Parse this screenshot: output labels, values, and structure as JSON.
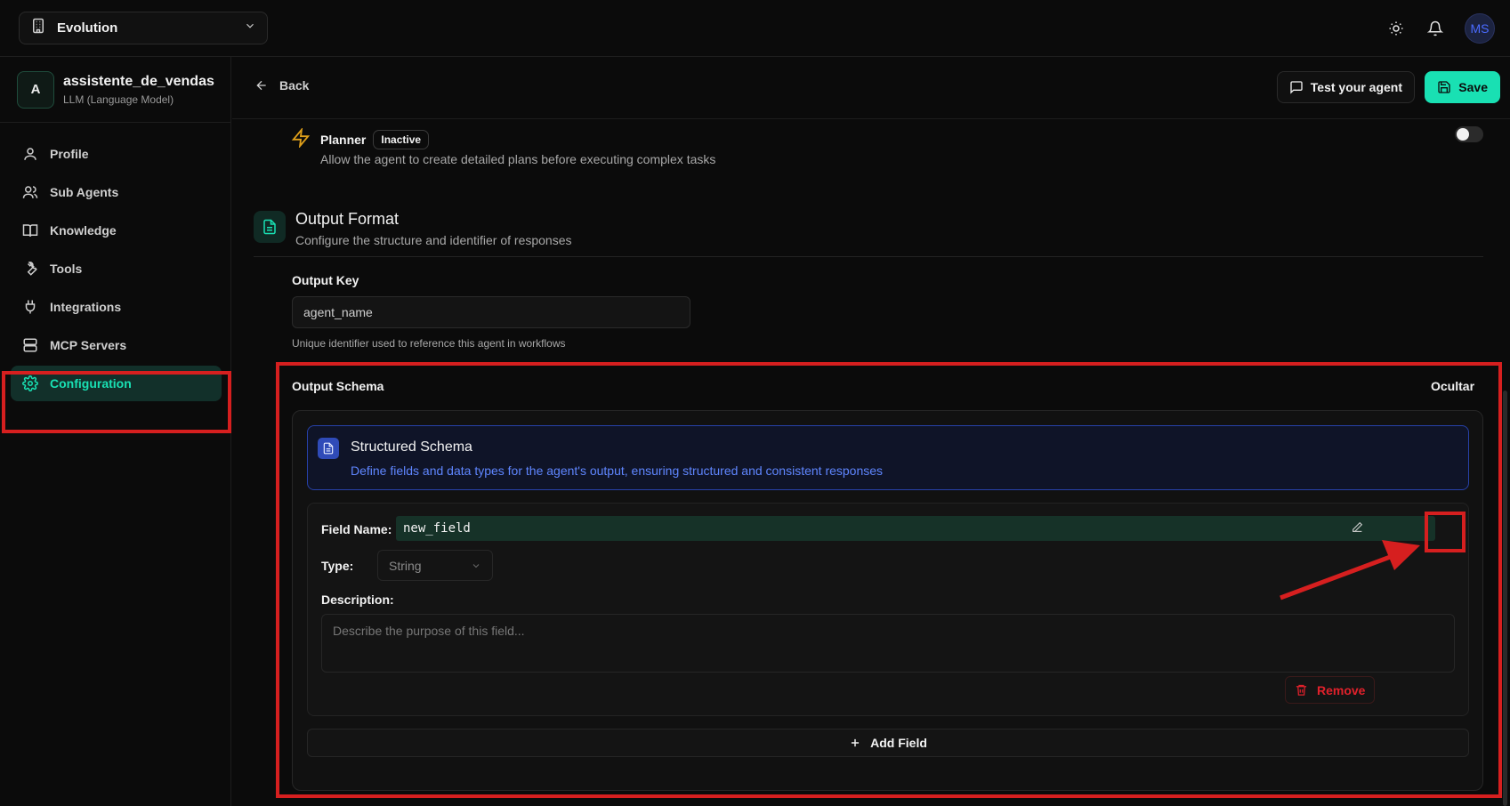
{
  "workspace": {
    "name": "Evolution"
  },
  "user": {
    "initials": "MS"
  },
  "agent": {
    "avatar_letter": "A",
    "name": "assistente_de_vendas",
    "type": "LLM (Language Model)"
  },
  "nav": {
    "items": [
      {
        "label": "Profile",
        "icon": "user-icon"
      },
      {
        "label": "Sub Agents",
        "icon": "users-icon"
      },
      {
        "label": "Knowledge",
        "icon": "book-icon"
      },
      {
        "label": "Tools",
        "icon": "wrench-icon"
      },
      {
        "label": "Integrations",
        "icon": "plug-icon"
      },
      {
        "label": "MCP Servers",
        "icon": "server-icon"
      },
      {
        "label": "Configuration",
        "icon": "gear-icon",
        "active": true
      }
    ]
  },
  "header": {
    "back_label": "Back",
    "test_label": "Test your agent",
    "save_label": "Save"
  },
  "planner": {
    "title": "Planner",
    "status": "Inactive",
    "description": "Allow the agent to create detailed plans before executing complex tasks",
    "enabled": false
  },
  "output_format": {
    "title": "Output Format",
    "description": "Configure the structure and identifier of responses",
    "output_key_label": "Output Key",
    "output_key_value": "agent_name",
    "output_key_help": "Unique identifier used to reference this agent in workflows"
  },
  "output_schema": {
    "label": "Output Schema",
    "toggle_label": "Ocultar",
    "info_title": "Structured Schema",
    "info_description": "Define fields and data types for the agent's output, ensuring structured and consistent responses",
    "field": {
      "name_label": "Field Name:",
      "name_value": "new_field",
      "type_label": "Type:",
      "type_value": "String",
      "description_label": "Description:",
      "description_placeholder": "Describe the purpose of this field...",
      "remove_label": "Remove"
    },
    "add_field_label": "Add Field"
  },
  "colors": {
    "accent": "#19e0b3",
    "danger": "#e0212b",
    "info": "#5f86ff",
    "annotation": "#d61f1f"
  }
}
